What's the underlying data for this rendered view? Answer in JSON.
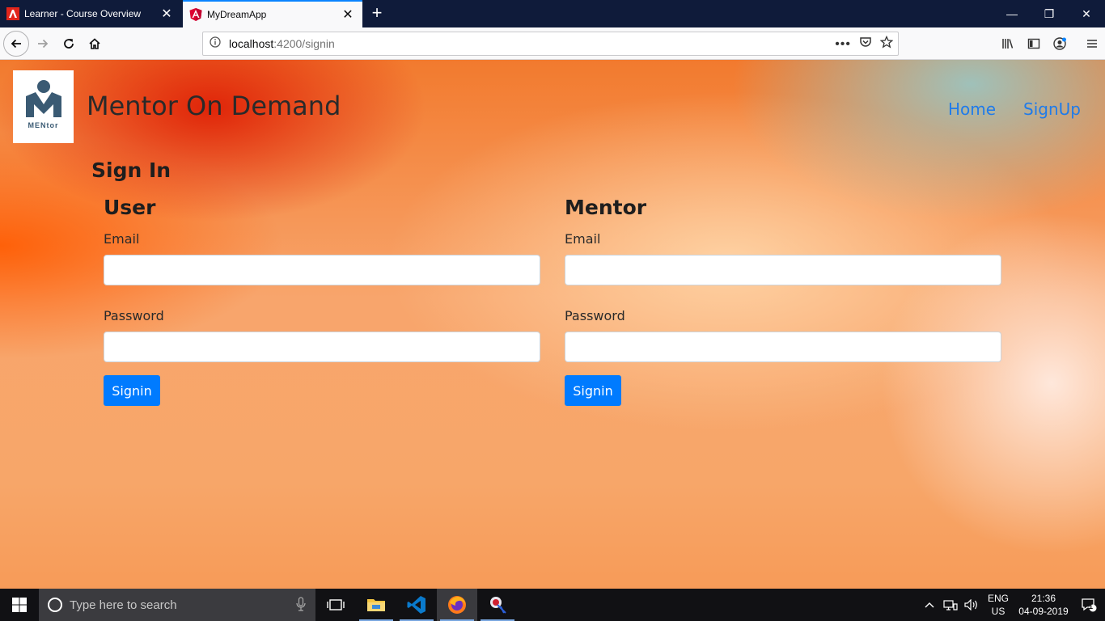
{
  "browser": {
    "tabs": [
      {
        "title": "Learner - Course Overview",
        "favicon": "adobe-icon",
        "active": false
      },
      {
        "title": "MyDreamApp",
        "favicon": "angular-icon",
        "active": true
      }
    ],
    "url": {
      "host": "localhost",
      "path": ":4200/signin"
    },
    "accent": "#0a84ff"
  },
  "app": {
    "logo_text": "MENtor",
    "brand": "Mentor On Demand",
    "nav": {
      "home": "Home",
      "signup": "SignUp"
    },
    "link_color": "#1f7bea"
  },
  "signin": {
    "title": "Sign In",
    "user": {
      "heading": "User",
      "email_label": "Email",
      "email_value": "",
      "password_label": "Password",
      "password_value": "",
      "button": "Signin"
    },
    "mentor": {
      "heading": "Mentor",
      "email_label": "Email",
      "email_value": "",
      "password_label": "Password",
      "password_value": "",
      "button": "Signin"
    },
    "button_color": "#007bff"
  },
  "taskbar": {
    "search_placeholder": "Type here to search",
    "lang_line1": "ENG",
    "lang_line2": "US",
    "time": "21:36",
    "date": "04-09-2019",
    "notification_count": "1"
  }
}
